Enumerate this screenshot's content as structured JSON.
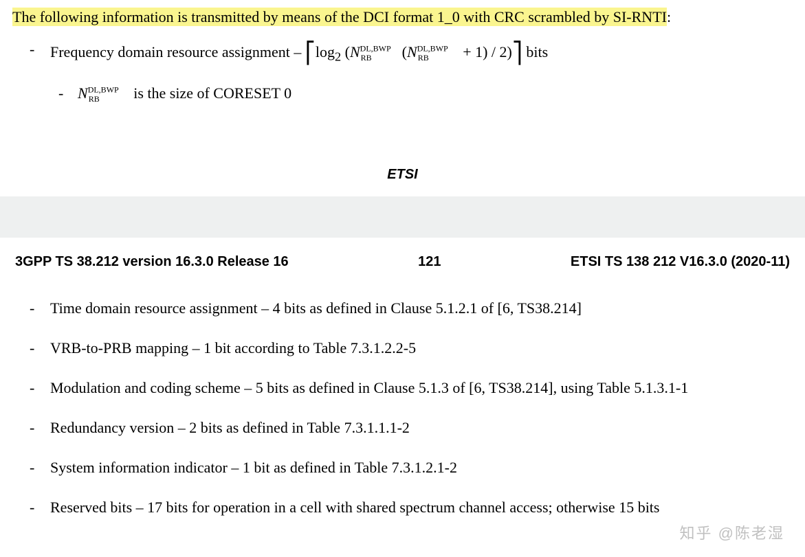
{
  "intro_highlighted": "The following information is transmitted by means of the DCI format 1_0 with CRC scrambled by SI-RNTI",
  "intro_tail": ":",
  "top_items": {
    "freq_prefix": "Frequency domain resource assignment – ",
    "freq_suffix": "  bits",
    "nrb_desc_suffix": " is the size of CORESET 0"
  },
  "formula": {
    "log": "log",
    "base": "2",
    "N": "N",
    "sup": "DL,BWP",
    "sub": "RB",
    "tail": " + 1) / 2)"
  },
  "etsi": "ETSI",
  "header": {
    "left": "3GPP TS 38.212 version 16.3.0 Release 16",
    "center": "121",
    "right": "ETSI TS 138 212 V16.3.0 (2020-11)"
  },
  "bottom_items": [
    "Time domain resource assignment – 4 bits as defined in Clause 5.1.2.1 of [6, TS38.214]",
    "VRB-to-PRB mapping – 1 bit according to Table 7.3.1.2.2-5",
    "Modulation and coding scheme – 5 bits as defined in Clause 5.1.3 of [6, TS38.214], using Table 5.1.3.1-1",
    "Redundancy version – 2 bits as defined in Table 7.3.1.1.1-2",
    "System information indicator – 1 bit as defined in Table 7.3.1.2.1-2",
    "Reserved bits –  17 bits for operation in a cell with shared spectrum channel access; otherwise 15 bits"
  ],
  "watermark": "知乎 @陈老湿"
}
